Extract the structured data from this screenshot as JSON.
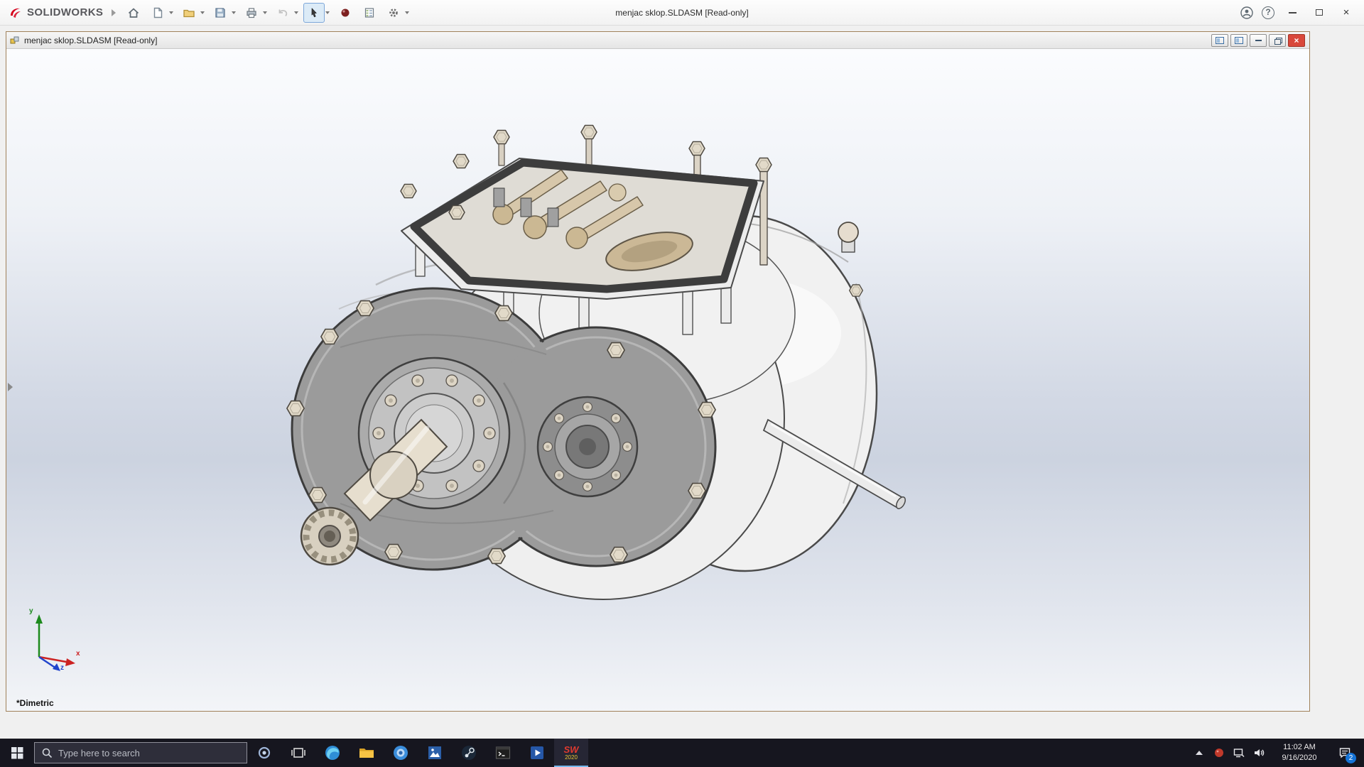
{
  "app": {
    "brand": "SOLIDWORKS",
    "title": "menjac sklop.SLDASM [Read-only]",
    "help_glyph": "?",
    "close_glyph": "×"
  },
  "document": {
    "title": "menjac sklop.SLDASM [Read-only]",
    "view_label": "*Dimetric",
    "close_glyph": "×"
  },
  "triad": {
    "x": "x",
    "y": "y",
    "z": "z"
  },
  "taskbar": {
    "search_placeholder": "Type here to search",
    "sw_mark": "SW",
    "sw_year": "2020",
    "time": "11:02 AM",
    "date": "9/16/2020",
    "notification_badge": "2"
  },
  "colors": {
    "accent_red": "#d6001c",
    "taskbar_bg": "#16161f",
    "close_red": "#d9483b",
    "viewport_mid": "#ccd3e0"
  }
}
